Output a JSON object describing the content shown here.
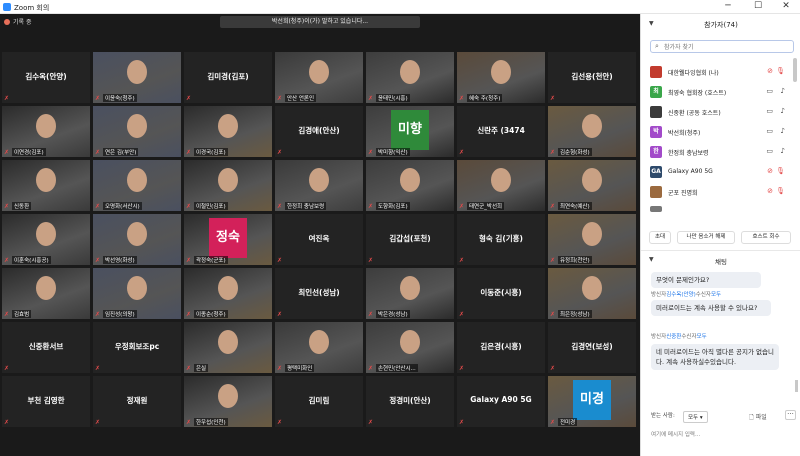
{
  "window": {
    "title": "Zoom 회의",
    "minimize": "─",
    "maximize": "☐",
    "close": "✕"
  },
  "recording": "기록 중",
  "speaking": "박선희(청주)이(가) 말하고 있습니다...",
  "tiles": [
    {
      "name": "김수옥(안양)",
      "caption": ""
    },
    {
      "name": "",
      "caption": "이윤숙(청주)"
    },
    {
      "name": "김미경(김포)",
      "caption": ""
    },
    {
      "name": "",
      "caption": "안산 언론인"
    },
    {
      "name": "",
      "caption": "윤태민(시흥)"
    },
    {
      "name": "",
      "caption": "혜숙 주(청주)"
    },
    {
      "name": "김선용(천안)",
      "caption": ""
    },
    {
      "name": "",
      "caption": "이연경(김포)"
    },
    {
      "name": "",
      "caption": "연은 김(부안)"
    },
    {
      "name": "",
      "caption": "이경국(김포)"
    },
    {
      "name": "김경애(안산)",
      "caption": ""
    },
    {
      "name": "",
      "caption": "박미향(익산)",
      "badge": "미향"
    },
    {
      "name": "신란주 (3474",
      "caption": ""
    },
    {
      "name": "",
      "caption": "김순형(화성)"
    },
    {
      "name": "",
      "caption": "신동환"
    },
    {
      "name": "",
      "caption": "오명화(서산시)"
    },
    {
      "name": "",
      "caption": "이철민(김포)"
    },
    {
      "name": "",
      "caption": "한정희 충남보령"
    },
    {
      "name": "",
      "caption": "도향화(김포)"
    },
    {
      "name": "",
      "caption": "태연군_박선희"
    },
    {
      "name": "",
      "caption": "최연숙(예산)"
    },
    {
      "name": "",
      "caption": "이훈숙(시흥공)"
    },
    {
      "name": "",
      "caption": "박선영(화성)"
    },
    {
      "name": "",
      "caption": "곽정숙(군포)",
      "badge": "정숙"
    },
    {
      "name": "여진옥",
      "caption": ""
    },
    {
      "name": "김갑섭(포천)",
      "caption": ""
    },
    {
      "name": "형숙 김(기흥)",
      "caption": ""
    },
    {
      "name": "",
      "caption": "유정희(천안)"
    },
    {
      "name": "",
      "caption": "김효범"
    },
    {
      "name": "",
      "caption": "임진성(의왕)"
    },
    {
      "name": "",
      "caption": "이종순(청주)"
    },
    {
      "name": "최인선(성남)",
      "caption": ""
    },
    {
      "name": "",
      "caption": "박은경(성남)"
    },
    {
      "name": "이동준(시흥)",
      "caption": ""
    },
    {
      "name": "",
      "caption": "최은정(성남)"
    },
    {
      "name": "신중환서브",
      "caption": ""
    },
    {
      "name": "우정회보조pc",
      "caption": ""
    },
    {
      "name": "",
      "caption": "은실"
    },
    {
      "name": "",
      "caption": "평택미화인"
    },
    {
      "name": "",
      "caption": "손현민(안산시..."
    },
    {
      "name": "김은경(시흥)",
      "caption": ""
    },
    {
      "name": "김경연(보성)",
      "caption": ""
    },
    {
      "name": "부천 김영한",
      "caption": ""
    },
    {
      "name": "정재원",
      "caption": ""
    },
    {
      "name": "",
      "caption": "한우섭(인천)"
    },
    {
      "name": "김미림",
      "caption": ""
    },
    {
      "name": "정경미(안산)",
      "caption": ""
    },
    {
      "name": "Galaxy A90 5G",
      "caption": ""
    },
    {
      "name": "",
      "caption": "전미경",
      "badge": "미경"
    }
  ],
  "participants": {
    "title": "참가자(74)",
    "search_placeholder": "참가자 찾기",
    "items": [
      {
        "avatar": "",
        "name": "대한웰다잉협회 (나)",
        "color": "#c23b2e"
      },
      {
        "avatar": "최",
        "name": "최영숙 협회장 (호스트)",
        "color": "#3aa64a"
      },
      {
        "avatar": "",
        "name": "신중환 (공동 호스트)",
        "color": "#3b3b3b"
      },
      {
        "avatar": "박",
        "name": "박선희(청주)",
        "color": "#a24ac9"
      },
      {
        "avatar": "한",
        "name": "한정희 충남보령",
        "color": "#a24ac9"
      },
      {
        "avatar": "GA",
        "name": "Galaxy A90 5G",
        "color": "#2e4a6b"
      },
      {
        "avatar": "",
        "name": "군포 진명희",
        "color": "#9b6a3f"
      },
      {
        "avatar": "",
        "name": "",
        "color": "#777777"
      }
    ],
    "buttons": {
      "invite": "초대",
      "mute_all": "나만 음소거 해제",
      "reclaim_host": "호스트 회수"
    }
  },
  "chat": {
    "title": "채팅",
    "messages": [
      {
        "text": "무엇이 문제인가요?"
      },
      {
        "sender": "방신자",
        "sender_highlight": "김수옥(안양)",
        "sender_suffix": "수신자",
        "to": "모두",
        "text": "미러로이드는 계속 사용할 수 있나요?"
      },
      {
        "sender": "방신자",
        "sender_highlight": "신중환",
        "sender_suffix": "수신자",
        "to": "모두",
        "text": "네 미러로이드는 아직 별다른 공지가 없습니다. 계속 사용하실수있습니다."
      }
    ],
    "to_label": "받는 사람:",
    "to_value": "모두",
    "file_label": "파일",
    "more_label": "···",
    "input_placeholder": "여기에 메시지 입력..."
  }
}
